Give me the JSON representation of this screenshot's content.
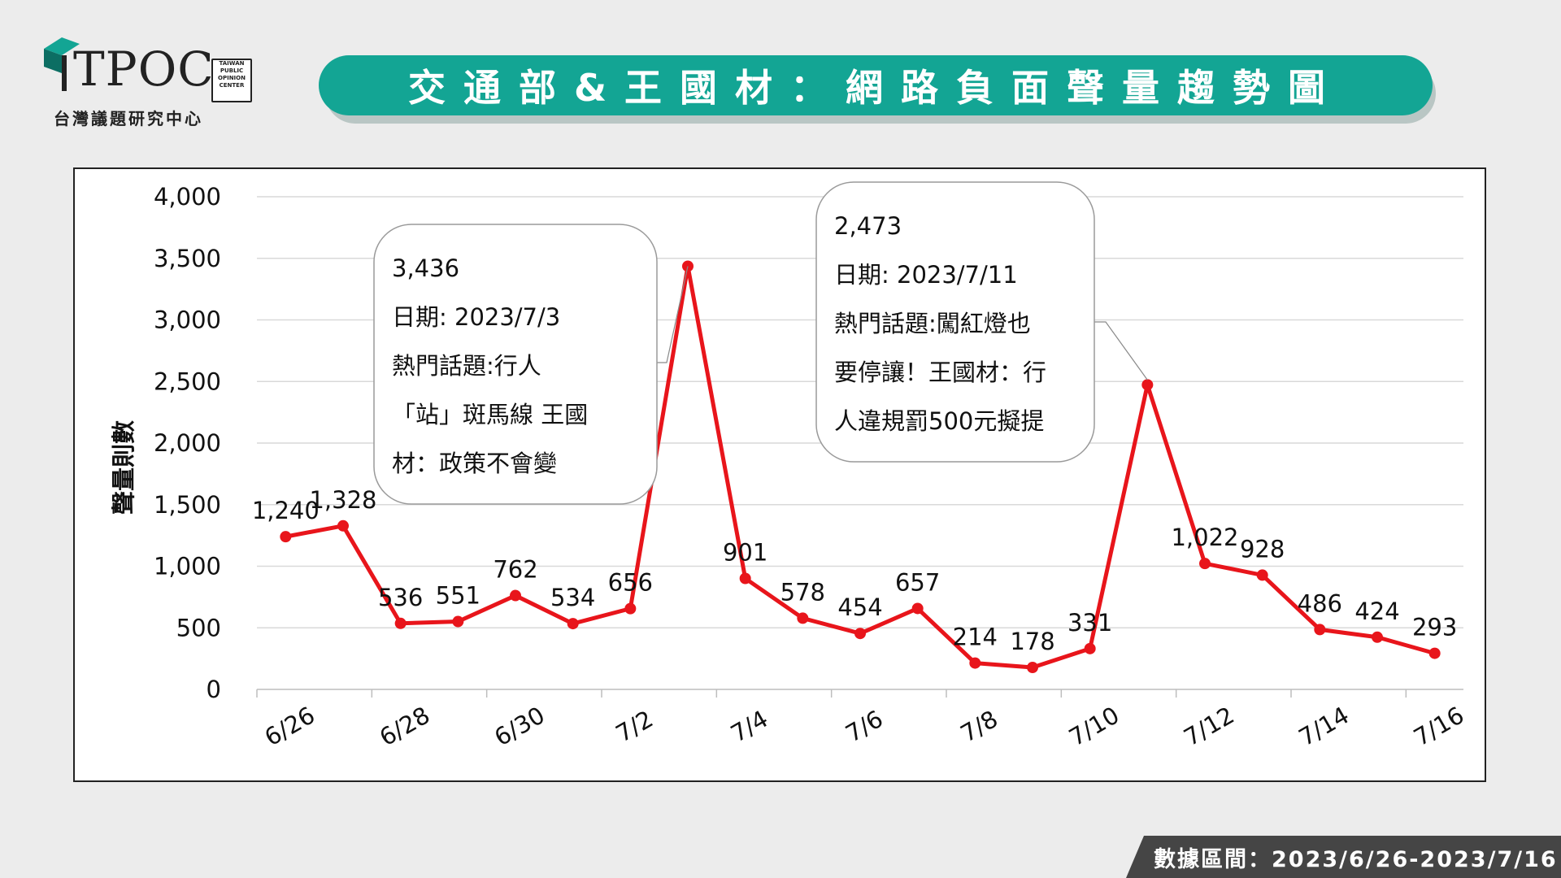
{
  "header": {
    "logo_text": "TPOC",
    "logo_badge": [
      "TAIWAN",
      "PUBLIC",
      "OPINION",
      "CENTER"
    ],
    "logo_subtitle": "台灣議題研究中心",
    "title": "交通部&王國材：網路負面聲量趨勢圖"
  },
  "footer": {
    "date_range": "數據區間：2023/6/26-2023/7/16"
  },
  "colors": {
    "accent": "#13a594",
    "line": "#e8151b",
    "footer_bg": "#454545"
  },
  "chart_data": {
    "type": "line",
    "title": "",
    "xlabel": "",
    "ylabel": "聲量則數",
    "ylim": [
      0,
      4000
    ],
    "y_ticks": [
      "0",
      "500",
      "1,000",
      "1,500",
      "2,000",
      "2,500",
      "3,000",
      "3,500",
      "4,000"
    ],
    "x_tick_labels": [
      "6/26",
      "6/28",
      "6/30",
      "7/2",
      "7/4",
      "7/6",
      "7/8",
      "7/10",
      "7/12",
      "7/14",
      "7/16"
    ],
    "grid": true,
    "legend": "none",
    "x": [
      "6/26",
      "6/27",
      "6/28",
      "6/29",
      "6/30",
      "7/1",
      "7/2",
      "7/3",
      "7/4",
      "7/5",
      "7/6",
      "7/7",
      "7/8",
      "7/9",
      "7/10",
      "7/11",
      "7/12",
      "7/13",
      "7/14",
      "7/15",
      "7/16"
    ],
    "series": [
      {
        "values": [
          1240,
          1328,
          536,
          551,
          762,
          534,
          656,
          3436,
          901,
          578,
          454,
          657,
          214,
          178,
          331,
          2473,
          1022,
          928,
          486,
          424,
          293
        ],
        "labels": [
          "1,240",
          "1,328",
          "536",
          "551",
          "762",
          "534",
          "656",
          "",
          "901",
          "578",
          "454",
          "657",
          "214",
          "178",
          "331",
          "",
          "1,022",
          "928",
          "486",
          "424",
          "293"
        ]
      }
    ],
    "annotations": [
      {
        "x": "7/3",
        "lines": [
          "3,436",
          "日期: 2023/7/3",
          "熱門話題:行人",
          "「站」斑馬線 王國",
          "材：政策不會變"
        ]
      },
      {
        "x": "7/11",
        "lines": [
          "2,473",
          "日期: 2023/7/11",
          "熱門話題:闖紅燈也",
          "要停讓！王國材：行",
          "人違規罰500元擬提"
        ]
      }
    ]
  }
}
